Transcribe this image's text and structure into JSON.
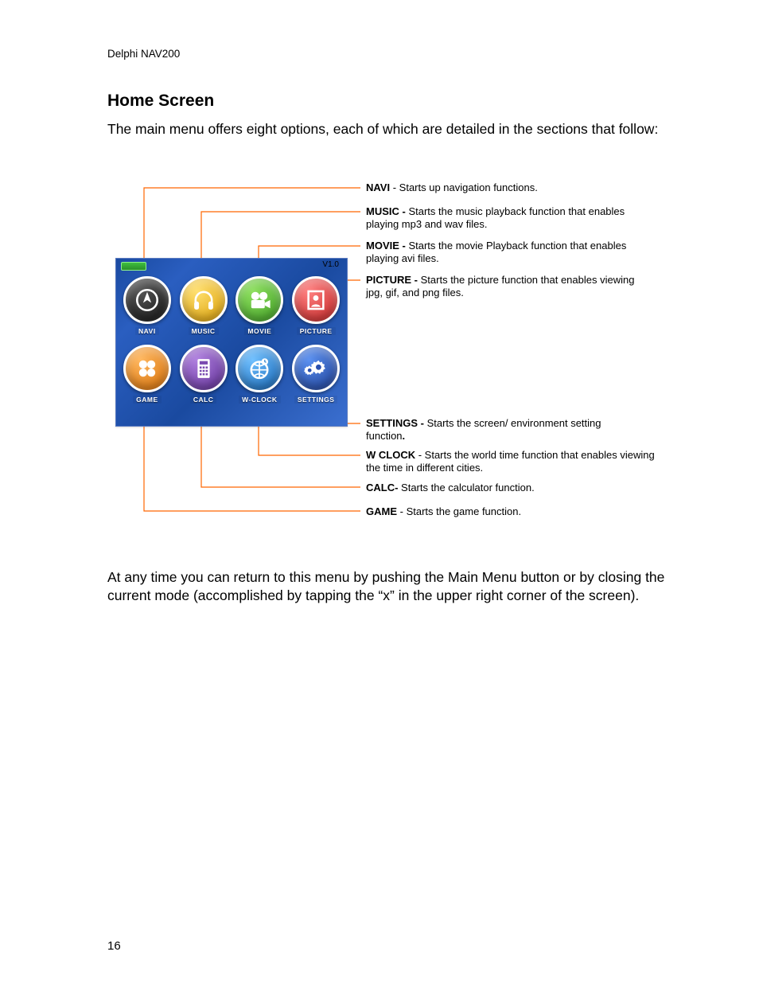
{
  "doc_header": "Delphi NAV200",
  "heading": "Home Screen",
  "intro": "The main menu offers eight options, each of which are detailed in the sections that follow:",
  "device": {
    "version": "V1.0",
    "apps": [
      {
        "label": "NAVI"
      },
      {
        "label": "MUSIC"
      },
      {
        "label": "MOVIE"
      },
      {
        "label": "PICTURE"
      },
      {
        "label": "GAME"
      },
      {
        "label": "CALC"
      },
      {
        "label": "W-CLOCK"
      },
      {
        "label": "SETTINGS"
      }
    ]
  },
  "callouts": {
    "navi": {
      "bold": "NAVI",
      "sep": " - ",
      "text": "Starts up navigation functions."
    },
    "music": {
      "bold": "MUSIC - ",
      "sep": "",
      "text": "Starts the music playback function that enables playing mp3 and wav files."
    },
    "movie": {
      "bold": "MOVIE - ",
      "sep": "",
      "text": "Starts the movie Playback function that enables playing avi files."
    },
    "picture": {
      "bold": "PICTURE - ",
      "sep": "",
      "text": "Starts the picture function that enables viewing jpg, gif, and png files."
    },
    "settings": {
      "bold": "SETTINGS - ",
      "sep": "",
      "text": "Starts the screen/ environment setting function",
      "trailbold": "."
    },
    "wclock": {
      "bold": "W CLOCK",
      "sep": " - ",
      "text": "Starts the world time function that enables viewing the time in different cities."
    },
    "calc": {
      "bold": "CALC- ",
      "sep": "",
      "text": "Starts the calculator function."
    },
    "game": {
      "bold": "GAME",
      "sep": " - ",
      "text": "Starts the game function."
    }
  },
  "outro": "At any time you can return to this menu by pushing the Main Menu button or by closing the current mode (accomplished by tapping the “x” in the upper right corner of the screen).",
  "page_number": "16"
}
